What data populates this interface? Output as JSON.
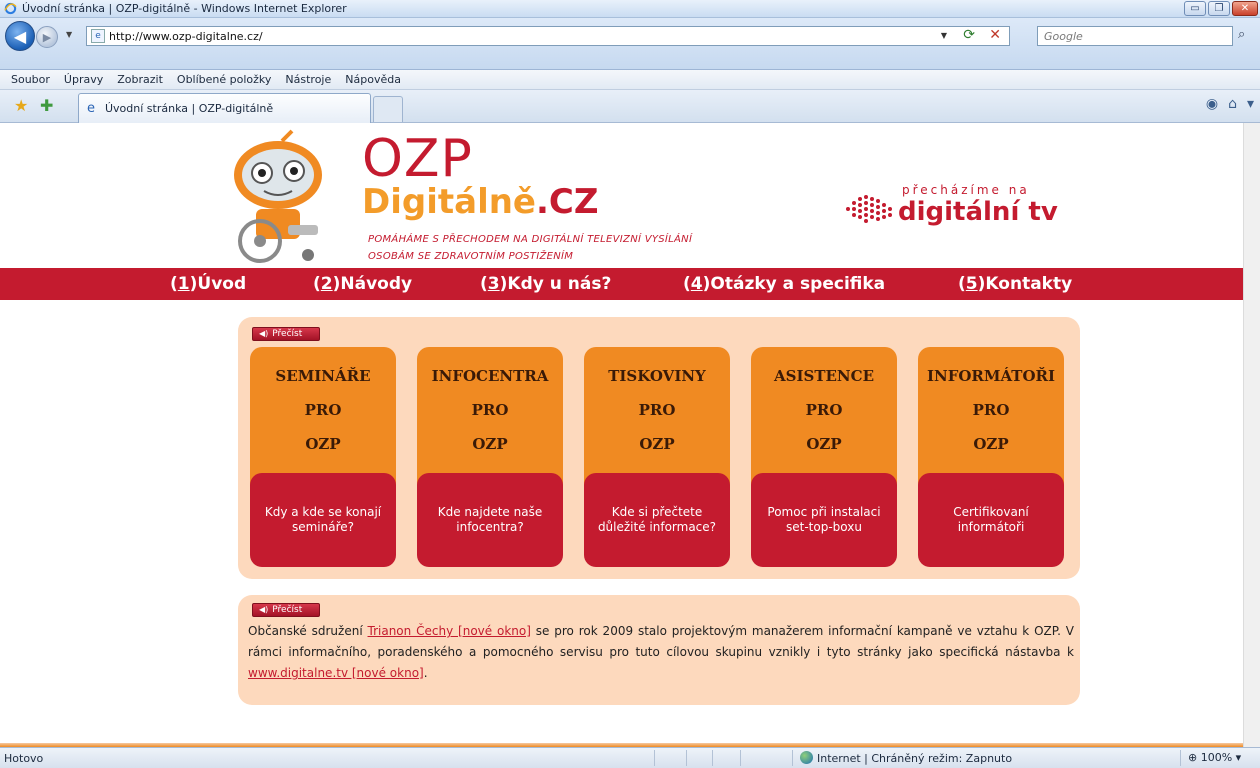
{
  "window": {
    "title": "Úvodní stránka | OZP-digitálně - Windows Internet Explorer",
    "buttons": {
      "minimize": "▭",
      "maximize": "❐",
      "close": "✕"
    }
  },
  "addressbar": {
    "url": "http://www.ozp-digitalne.cz/",
    "search_placeholder": "Google"
  },
  "menu": [
    "Soubor",
    "Úpravy",
    "Zobrazit",
    "Oblíbené položky",
    "Nástroje",
    "Nápověda"
  ],
  "tab": {
    "label": "Úvodní stránka | OZP-digitálně"
  },
  "header": {
    "logo_top": "OZP",
    "logo_main": "Digitálně",
    "logo_suffix": ".CZ",
    "tagline_1": "POMÁHÁME S PŘECHODEM NA DIGITÁLNÍ TELEVIZNÍ VYSÍLÁNÍ",
    "tagline_2": "OSOBÁM SE ZDRAVOTNÍM POSTIŽENÍM",
    "dtv_small": "přecházíme na",
    "dtv_big": "digitální tv"
  },
  "nav": [
    {
      "num": "1",
      "label": "Úvod"
    },
    {
      "num": "2",
      "label": "Návody"
    },
    {
      "num": "3",
      "label": "Kdy u nás?"
    },
    {
      "num": "4",
      "label": "Otázky a specifika"
    },
    {
      "num": "5",
      "label": "Kontakty"
    }
  ],
  "precist_label": "Přečíst",
  "cards": [
    {
      "title": "SEMINÁŘE",
      "line2": "PRO",
      "line3": "OZP",
      "desc": "Kdy a kde se konají semináře?"
    },
    {
      "title": "INFOCENTRA",
      "line2": "PRO",
      "line3": "OZP",
      "desc": "Kde najdete naše infocentra?"
    },
    {
      "title": "TISKOVINY",
      "line2": "PRO",
      "line3": "OZP",
      "desc": "Kde si přečtete důležité informace?"
    },
    {
      "title": "ASISTENCE",
      "line2": "PRO",
      "line3": "OZP",
      "desc": "Pomoc při instalaci set-top-boxu"
    },
    {
      "title": "INFORMÁTOŘI",
      "line2": "PRO",
      "line3": "OZP",
      "desc": "Certifikovaní informátoři"
    }
  ],
  "about": {
    "part1": "Občanské sdružení ",
    "link1": "Trianon Čechy [nové okno]",
    "part2": " se pro rok 2009 stalo projektovým manažerem informační kampaně ve vztahu k OZP. V rámci informačního, poradenského a pomocného servisu pro tuto cílovou skupinu vznikly i tyto stránky jako specifická nástavba k ",
    "link2": "www.digitalne.tv [nové okno]",
    "part3": "."
  },
  "status": {
    "text": "Hotovo",
    "zone": "Internet | Chráněný režim: Zapnuto",
    "zoom": "100%"
  },
  "colors": {
    "brand_red": "#c41b2f",
    "brand_orange": "#f08a22",
    "panel_bg": "#fdd9bd"
  }
}
